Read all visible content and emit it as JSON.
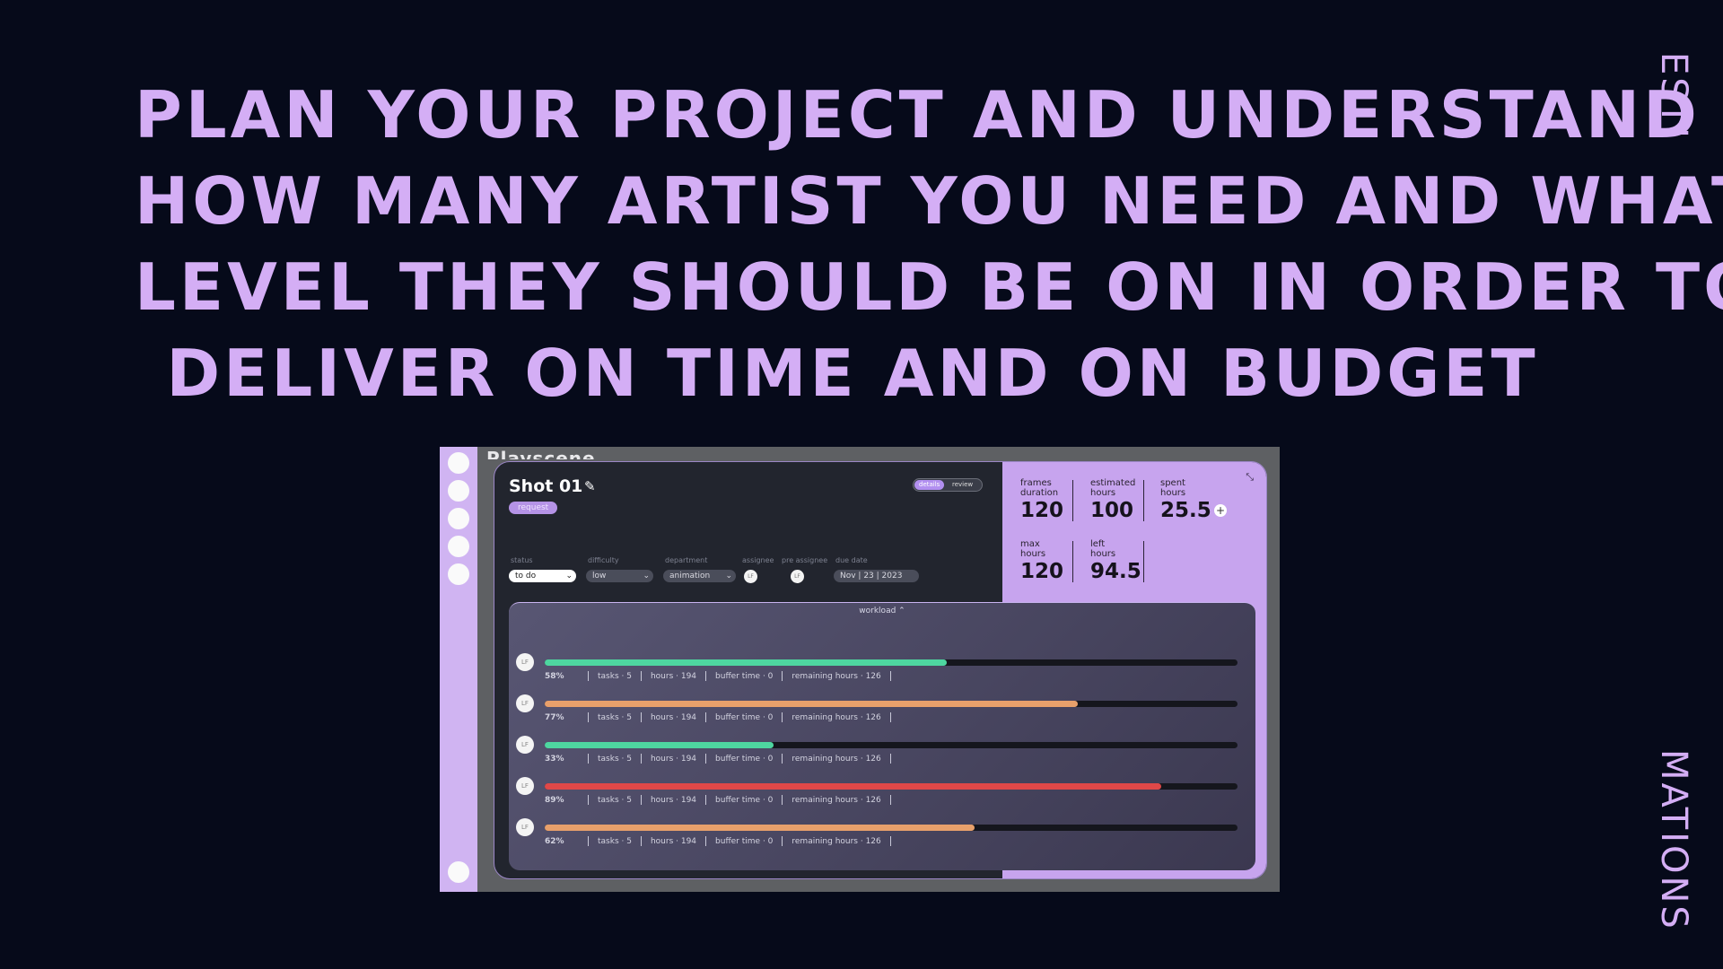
{
  "headline": [
    "PLAN YOUR PROJECT AND UNDERSTAND",
    "HOW MANY ARTIST YOU NEED AND WHAT",
    "LEVEL THEY SHOULD BE ON IN ORDER TO",
    "DELIVER ON TIME AND ON BUDGET"
  ],
  "side_top": "ESTI",
  "side_bottom": "MATIONS",
  "colors": {
    "background": "#060a1a",
    "accent": "#d4aef5",
    "green": "#4ed6a0",
    "orange": "#e8a06b",
    "red": "#e04848"
  },
  "app": {
    "window_title": "Playscene",
    "shot_name": "Shot 01",
    "badge": "request",
    "tabs": [
      "details",
      "review"
    ],
    "fields": [
      {
        "label": "status",
        "value": "to do"
      },
      {
        "label": "difficulty",
        "value": "low"
      },
      {
        "label": "department",
        "value": "animation"
      },
      {
        "label": "assignee",
        "value": "LF"
      },
      {
        "label": "pre assignee",
        "value": "LF"
      },
      {
        "label": "due date",
        "value": "Nov | 23 | 2023"
      }
    ],
    "metrics": [
      {
        "label": "frames\nduration",
        "value": "120"
      },
      {
        "label": "estimated\nhours",
        "value": "100"
      },
      {
        "label": "spent\nhours",
        "value": "25.5"
      },
      {
        "label": "max\nhours",
        "value": "120"
      },
      {
        "label": "left\nhours",
        "value": "94.5"
      }
    ],
    "workload_title": "workload ⌃",
    "workload": [
      {
        "avatar": "LF",
        "percent": "58%",
        "fill": 0.58,
        "color": "#4ed6a0",
        "tasks": "tasks · 5",
        "hours": "hours · 194",
        "buffer": "buffer time · 0",
        "remaining": "remaining hours · 126"
      },
      {
        "avatar": "LF",
        "percent": "77%",
        "fill": 0.77,
        "color": "#e8a06b",
        "tasks": "tasks · 5",
        "hours": "hours · 194",
        "buffer": "buffer time · 0",
        "remaining": "remaining hours · 126"
      },
      {
        "avatar": "LF",
        "percent": "33%",
        "fill": 0.33,
        "color": "#4ed6a0",
        "tasks": "tasks · 5",
        "hours": "hours · 194",
        "buffer": "buffer time · 0",
        "remaining": "remaining hours · 126"
      },
      {
        "avatar": "LF",
        "percent": "89%",
        "fill": 0.89,
        "color": "#e04848",
        "tasks": "tasks · 5",
        "hours": "hours · 194",
        "buffer": "buffer time · 0",
        "remaining": "remaining hours · 126"
      },
      {
        "avatar": "LF",
        "percent": "62%",
        "fill": 0.62,
        "color": "#e8a06b",
        "tasks": "tasks · 5",
        "hours": "hours · 194",
        "buffer": "buffer time · 0",
        "remaining": "remaining hours · 126"
      }
    ]
  }
}
